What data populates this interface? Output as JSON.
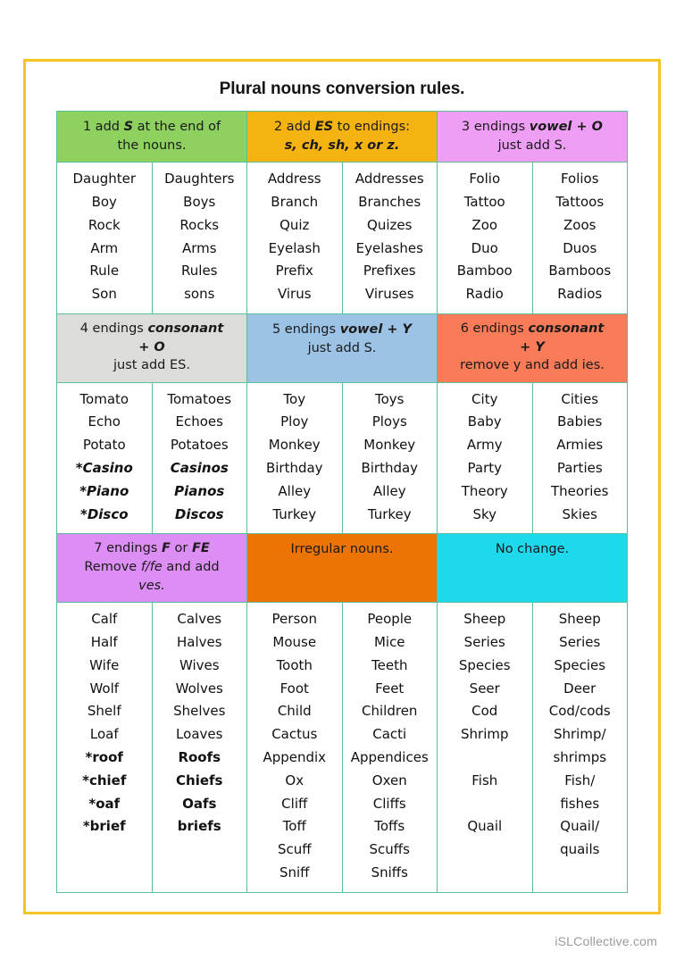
{
  "page": {
    "title": "Plural nouns conversion rules.",
    "watermark": "iSLCollective.com",
    "frame_color": "#f5c323",
    "grid_line_color": "#5cbf97"
  },
  "blocks": [
    {
      "rules": [
        {
          "id": "rule-1",
          "color": "#8ed15f",
          "color_name": "green",
          "number": "1",
          "lines": [
            [
              {
                "t": "1 add ",
                "b": false
              },
              {
                "t": "S",
                "b": true
              },
              {
                "t": " at the end of",
                "b": false
              }
            ],
            [
              {
                "t": "the nouns.",
                "b": false
              }
            ]
          ]
        },
        {
          "id": "rule-2",
          "color": "#f5b312",
          "color_name": "amber",
          "number": "2",
          "lines": [
            [
              {
                "t": "2 add ",
                "b": false
              },
              {
                "t": "ES",
                "b": true
              },
              {
                "t": "  to endings:",
                "b": false
              }
            ],
            [
              {
                "t": "s, ch, sh, x or z.",
                "b": true
              }
            ]
          ]
        },
        {
          "id": "rule-3",
          "color": "#ef9ef6",
          "color_name": "pink",
          "number": "3",
          "lines": [
            [
              {
                "t": "3 endings ",
                "b": false
              },
              {
                "t": "vowel + O",
                "b": true
              }
            ],
            [
              {
                "t": "just add S.",
                "b": false
              }
            ]
          ]
        }
      ],
      "columns": [
        {
          "header": "rule-1-singular",
          "words": [
            {
              "w": "Daughter"
            },
            {
              "w": "Boy"
            },
            {
              "w": "Rock"
            },
            {
              "w": "Arm"
            },
            {
              "w": "Rule"
            },
            {
              "w": "Son"
            }
          ]
        },
        {
          "header": "rule-1-plural",
          "words": [
            {
              "w": "Daughters"
            },
            {
              "w": "Boys"
            },
            {
              "w": "Rocks"
            },
            {
              "w": "Arms"
            },
            {
              "w": "Rules"
            },
            {
              "w": "sons"
            }
          ]
        },
        {
          "header": "rule-2-singular",
          "words": [
            {
              "w": "Address"
            },
            {
              "w": "Branch"
            },
            {
              "w": "Quiz"
            },
            {
              "w": "Eyelash"
            },
            {
              "w": "Prefix"
            },
            {
              "w": "Virus"
            }
          ]
        },
        {
          "header": "rule-2-plural",
          "words": [
            {
              "w": "Addresses"
            },
            {
              "w": "Branches"
            },
            {
              "w": "Quizes"
            },
            {
              "w": "Eyelashes"
            },
            {
              "w": "Prefixes"
            },
            {
              "w": "Viruses"
            }
          ]
        },
        {
          "header": "rule-3-singular",
          "words": [
            {
              "w": "Folio"
            },
            {
              "w": "Tattoo"
            },
            {
              "w": "Zoo"
            },
            {
              "w": "Duo"
            },
            {
              "w": "Bamboo"
            },
            {
              "w": "Radio"
            }
          ]
        },
        {
          "header": "rule-3-plural",
          "words": [
            {
              "w": "Folios"
            },
            {
              "w": "Tattoos"
            },
            {
              "w": "Zoos"
            },
            {
              "w": "Duos"
            },
            {
              "w": "Bamboos"
            },
            {
              "w": "Radios"
            }
          ]
        }
      ]
    },
    {
      "rules": [
        {
          "id": "rule-4",
          "color": "#dcdcd9",
          "color_name": "gray",
          "number": "4",
          "lines": [
            [
              {
                "t": "4 endings ",
                "b": false
              },
              {
                "t": "consonant",
                "b": true
              }
            ],
            [
              {
                "t": "+ O",
                "b": true
              }
            ],
            [
              {
                "t": "just add ES.",
                "b": false
              }
            ]
          ]
        },
        {
          "id": "rule-5",
          "color": "#9cc3e5",
          "color_name": "blue",
          "number": "5",
          "lines": [
            [
              {
                "t": "5 endings ",
                "b": false
              },
              {
                "t": "vowel + Y",
                "b": true
              }
            ],
            [
              {
                "t": "just add S.",
                "b": false
              }
            ]
          ]
        },
        {
          "id": "rule-6",
          "color": "#fa7b57",
          "color_name": "salmon",
          "number": "6",
          "lines": [
            [
              {
                "t": "6 endings ",
                "b": false
              },
              {
                "t": "consonant",
                "b": true
              }
            ],
            [
              {
                "t": "+ Y",
                "b": true
              }
            ],
            [
              {
                "t": "remove y and add ies.",
                "b": false
              }
            ]
          ]
        }
      ],
      "columns": [
        {
          "header": "rule-4-singular",
          "words": [
            {
              "w": "Tomato"
            },
            {
              "w": "Echo"
            },
            {
              "w": "Potato"
            },
            {
              "w": "*Casino",
              "style": "star-italic"
            },
            {
              "w": "*Piano",
              "style": "star-italic"
            },
            {
              "w": "*Disco",
              "style": "star-italic"
            }
          ]
        },
        {
          "header": "rule-4-plural",
          "words": [
            {
              "w": "Tomatoes"
            },
            {
              "w": "Echoes"
            },
            {
              "w": "Potatoes"
            },
            {
              "w": "Casinos",
              "style": "star-italic"
            },
            {
              "w": "Pianos",
              "style": "star-italic"
            },
            {
              "w": "Discos",
              "style": "star-italic"
            }
          ]
        },
        {
          "header": "rule-5-singular",
          "words": [
            {
              "w": "Toy"
            },
            {
              "w": "Ploy"
            },
            {
              "w": "Monkey"
            },
            {
              "w": "Birthday"
            },
            {
              "w": "Alley"
            },
            {
              "w": "Turkey"
            }
          ]
        },
        {
          "header": "rule-5-plural",
          "words": [
            {
              "w": "Toys"
            },
            {
              "w": "Ploys"
            },
            {
              "w": "Monkey"
            },
            {
              "w": "Birthday"
            },
            {
              "w": "Alley"
            },
            {
              "w": "Turkey"
            }
          ]
        },
        {
          "header": "rule-6-singular",
          "words": [
            {
              "w": "City"
            },
            {
              "w": "Baby"
            },
            {
              "w": "Army"
            },
            {
              "w": "Party"
            },
            {
              "w": "Theory"
            },
            {
              "w": "Sky"
            }
          ]
        },
        {
          "header": "rule-6-plural",
          "words": [
            {
              "w": "Cities"
            },
            {
              "w": "Babies"
            },
            {
              "w": "Armies"
            },
            {
              "w": "Parties"
            },
            {
              "w": "Theories"
            },
            {
              "w": "Skies"
            }
          ]
        }
      ]
    },
    {
      "rules": [
        {
          "id": "rule-7",
          "color": "#dd8ef5",
          "color_name": "purple",
          "number": "7",
          "lines": [
            [
              {
                "t": "7 endings ",
                "b": false
              },
              {
                "t": "F",
                "b": true
              },
              {
                "t": " or ",
                "b": false
              },
              {
                "t": "FE",
                "b": true
              }
            ],
            [
              {
                "t": "Remove ",
                "b": false
              },
              {
                "t": "f/fe",
                "b": false,
                "i": true
              },
              {
                "t": " and add",
                "b": false
              }
            ],
            [
              {
                "t": "ves.",
                "b": false,
                "i": true
              }
            ]
          ]
        },
        {
          "id": "rule-irregular",
          "color": "#ec7404",
          "color_name": "orange",
          "number": "",
          "lines": [
            [
              {
                "t": "Irregular nouns.",
                "b": false
              }
            ]
          ]
        },
        {
          "id": "rule-no-change",
          "color": "#1ed8ec",
          "color_name": "cyan",
          "number": "",
          "lines": [
            [
              {
                "t": "No change.",
                "b": false
              }
            ]
          ]
        }
      ],
      "columns": [
        {
          "header": "rule-7-singular",
          "words": [
            {
              "w": "Calf"
            },
            {
              "w": "Half"
            },
            {
              "w": "Wife"
            },
            {
              "w": "Wolf"
            },
            {
              "w": "Shelf"
            },
            {
              "w": "Loaf"
            },
            {
              "w": "*roof",
              "style": "star"
            },
            {
              "w": "*chief",
              "style": "star"
            },
            {
              "w": "*oaf",
              "style": "star"
            },
            {
              "w": "*brief",
              "style": "star"
            }
          ]
        },
        {
          "header": "rule-7-plural",
          "words": [
            {
              "w": "Calves"
            },
            {
              "w": "Halves"
            },
            {
              "w": "Wives"
            },
            {
              "w": "Wolves"
            },
            {
              "w": "Shelves"
            },
            {
              "w": "Loaves"
            },
            {
              "w": "Roofs",
              "style": "star"
            },
            {
              "w": "Chiefs",
              "style": "star"
            },
            {
              "w": "Oafs",
              "style": "star"
            },
            {
              "w": "briefs",
              "style": "star"
            }
          ]
        },
        {
          "header": "irregular-singular",
          "words": [
            {
              "w": "Person"
            },
            {
              "w": "Mouse"
            },
            {
              "w": "Tooth"
            },
            {
              "w": "Foot"
            },
            {
              "w": "Child"
            },
            {
              "w": "Cactus"
            },
            {
              "w": "Appendix"
            },
            {
              "w": "Ox"
            },
            {
              "w": "Cliff"
            },
            {
              "w": "Toff"
            },
            {
              "w": "Scuff"
            },
            {
              "w": "Sniff"
            }
          ]
        },
        {
          "header": "irregular-plural",
          "words": [
            {
              "w": "People"
            },
            {
              "w": "Mice"
            },
            {
              "w": "Teeth"
            },
            {
              "w": "Feet"
            },
            {
              "w": "Children"
            },
            {
              "w": "Cacti"
            },
            {
              "w": "Appendices"
            },
            {
              "w": "Oxen"
            },
            {
              "w": "Cliffs"
            },
            {
              "w": "Toffs"
            },
            {
              "w": "Scuffs"
            },
            {
              "w": "Sniffs"
            }
          ]
        },
        {
          "header": "no-change-singular",
          "words": [
            {
              "w": "Sheep"
            },
            {
              "w": "Series"
            },
            {
              "w": "Species"
            },
            {
              "w": "Seer"
            },
            {
              "w": "Cod"
            },
            {
              "w": "Shrimp"
            },
            {
              "w": "",
              "style": "blank"
            },
            {
              "w": "Fish"
            },
            {
              "w": "",
              "style": "blank"
            },
            {
              "w": "Quail"
            }
          ]
        },
        {
          "header": "no-change-plural",
          "words": [
            {
              "w": "Sheep"
            },
            {
              "w": "Series"
            },
            {
              "w": "Species"
            },
            {
              "w": "Deer"
            },
            {
              "w": "Cod/cods"
            },
            {
              "w": "Shrimp/",
              "style": "wrap"
            },
            {
              "w": "shrimps",
              "style": "wrap"
            },
            {
              "w": "Fish/",
              "style": "wrap"
            },
            {
              "w": "fishes",
              "style": "wrap"
            },
            {
              "w": "Quail/",
              "style": "wrap"
            },
            {
              "w": "quails",
              "style": "wrap"
            }
          ]
        }
      ]
    }
  ]
}
